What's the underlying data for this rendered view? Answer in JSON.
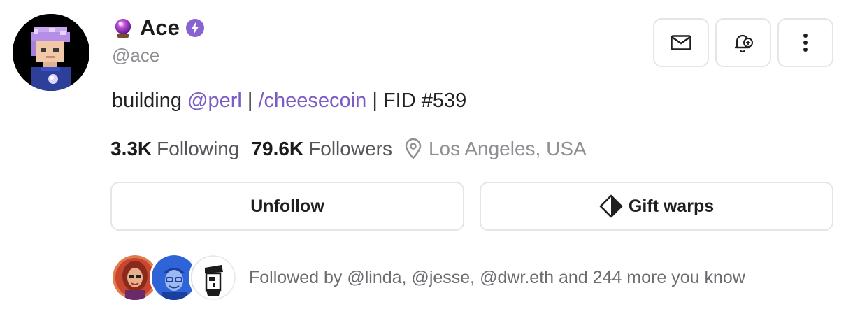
{
  "profile": {
    "display_name": "Ace",
    "handle": "@ace",
    "bio": {
      "prefix": "building ",
      "mention": "@perl",
      "sep1": " | ",
      "channel": "/cheesecoin",
      "sep2": " | ",
      "fid": "FID #539"
    },
    "following_count": "3.3K",
    "following_label": "Following",
    "followers_count": "79.6K",
    "followers_label": "Followers",
    "location": "Los Angeles, USA"
  },
  "actions": {
    "unfollow_label": "Unfollow",
    "gift_label": "Gift warps"
  },
  "mutuals": {
    "text": "Followed by @linda, @jesse, @dwr.eth and 244 more you know"
  },
  "icons": {
    "orb": "crystal-ball-icon",
    "verified": "lightning-badge-icon",
    "message": "envelope-icon",
    "notify": "bell-plus-icon",
    "more": "more-vertical-icon",
    "location": "map-pin-icon",
    "gift": "diamond-icon"
  },
  "colors": {
    "accent": "#7c5cc4",
    "verified": "#8a63d2",
    "muted": "#8f8f94",
    "border": "#e5e5e7"
  }
}
